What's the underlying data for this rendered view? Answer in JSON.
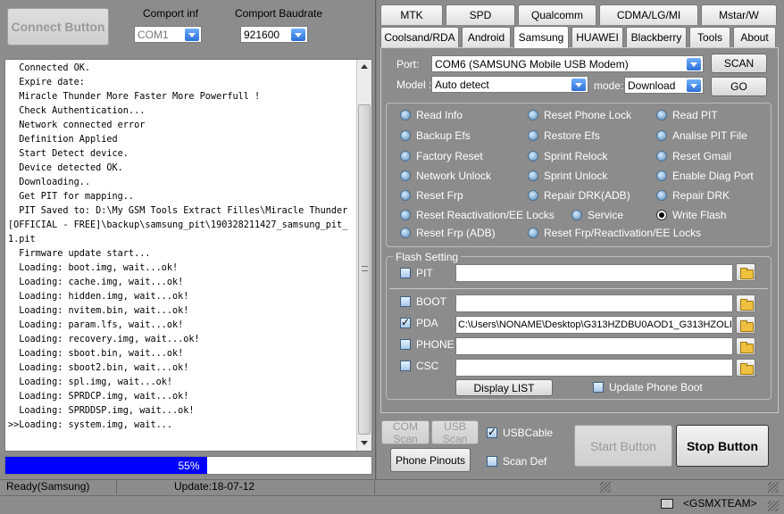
{
  "top": {
    "connect_button": "Connect Button",
    "comport_label": "Comport inf",
    "comport_value": "COM1",
    "baud_label": "Comport Baudrate",
    "baud_value": "921600"
  },
  "log_lines": [
    "  Connected OK.",
    "  Expire date:",
    "  Miracle Thunder More Faster More Powerfull !",
    "  Check Authentication...",
    "  Network connected error",
    "  Definition Applied",
    "  Start Detect device.",
    "  Device detected OK.",
    "  Downloading..",
    "  Get PIT for mapping..",
    "  PIT Saved to: D:\\My GSM Tools Extract Filles\\Miracle Thunder",
    "[OFFICIAL - FREE]\\backup\\samsung_pit\\190328211427_samsung_pit_",
    "1.pit",
    "  Firmware update start...",
    "  Loading: boot.img, wait...ok!",
    "  Loading: cache.img, wait...ok!",
    "  Loading: hidden.img, wait...ok!",
    "  Loading: nvitem.bin, wait...ok!",
    "  Loading: param.lfs, wait...ok!",
    "  Loading: recovery.img, wait...ok!",
    "  Loading: sboot.bin, wait...ok!",
    "  Loading: sboot2.bin, wait...ok!",
    "  Loading: spl.img, wait...ok!",
    "  Loading: SPRDCP.img, wait...ok!",
    "  Loading: SPRDDSP.img, wait...ok!",
    ">>Loading: system.img, wait..."
  ],
  "progress": {
    "percent": 55,
    "label": "55%"
  },
  "status": {
    "left": "Ready(Samsung)",
    "update": "Update:18-07-12",
    "team": "<GSMXTEAM>"
  },
  "tabs_row1": [
    "MTK",
    "SPD",
    "Qualcomm",
    "CDMA/LG/MI",
    "Mstar/W"
  ],
  "tabs_row2": [
    "Coolsand/RDA",
    "Android",
    "Samsung",
    "HUAWEI",
    "Blackberry",
    "Tools",
    "About"
  ],
  "active_tab": "Samsung",
  "port": {
    "label": "Port:",
    "value": "COM6 (SAMSUNG Mobile USB Modem)",
    "scan": "SCAN"
  },
  "model": {
    "label": "Model :",
    "value": "Auto detect",
    "mode_label": "mode:",
    "mode_value": "Download",
    "go": "GO"
  },
  "radios": {
    "read_info": "Read Info",
    "reset_phone_lock": "Reset Phone Lock",
    "read_pit": "Read PIT",
    "backup_efs": "Backup Efs",
    "restore_efs": "Restore Efs",
    "analise_pit": "Analise PIT File",
    "factory_reset": "Factory Reset",
    "sprint_relock": "Sprint Relock",
    "reset_gmail": "Reset Gmail",
    "network_unlock": "Network Unlock",
    "sprint_unlock": "Sprint Unlock",
    "enable_diag": "Enable Diag Port",
    "reset_frp": "Reset Frp",
    "repair_drk_adb": "Repair DRK(ADB)",
    "repair_drk": "Repair DRK",
    "reset_reactivation": "Reset Reactivation/EE Locks",
    "service": "Service",
    "write_flash": "Write Flash",
    "reset_frp_adb": "Reset Frp (ADB)",
    "reset_frp_reactivation": "Reset Frp/Reactivation/EE Locks"
  },
  "flash": {
    "title": "Flash Setting",
    "pit": "PIT",
    "boot": "BOOT",
    "pda": "PDA",
    "phone": "PHONE",
    "csc": "CSC",
    "pda_path": "C:\\Users\\NONAME\\Desktop\\G313HZDBU0AOD1_G313HZOLI",
    "display_list": "Display LIST",
    "update_phone_boot": "Update Phone Boot"
  },
  "bottom": {
    "com_scan": "COM Scan",
    "usb_scan": "USB Scan",
    "usb_cable": "USBCable",
    "phone_pinouts": "Phone Pinouts",
    "scan_def": "Scan Def",
    "start": "Start Button",
    "stop": "Stop Button"
  }
}
